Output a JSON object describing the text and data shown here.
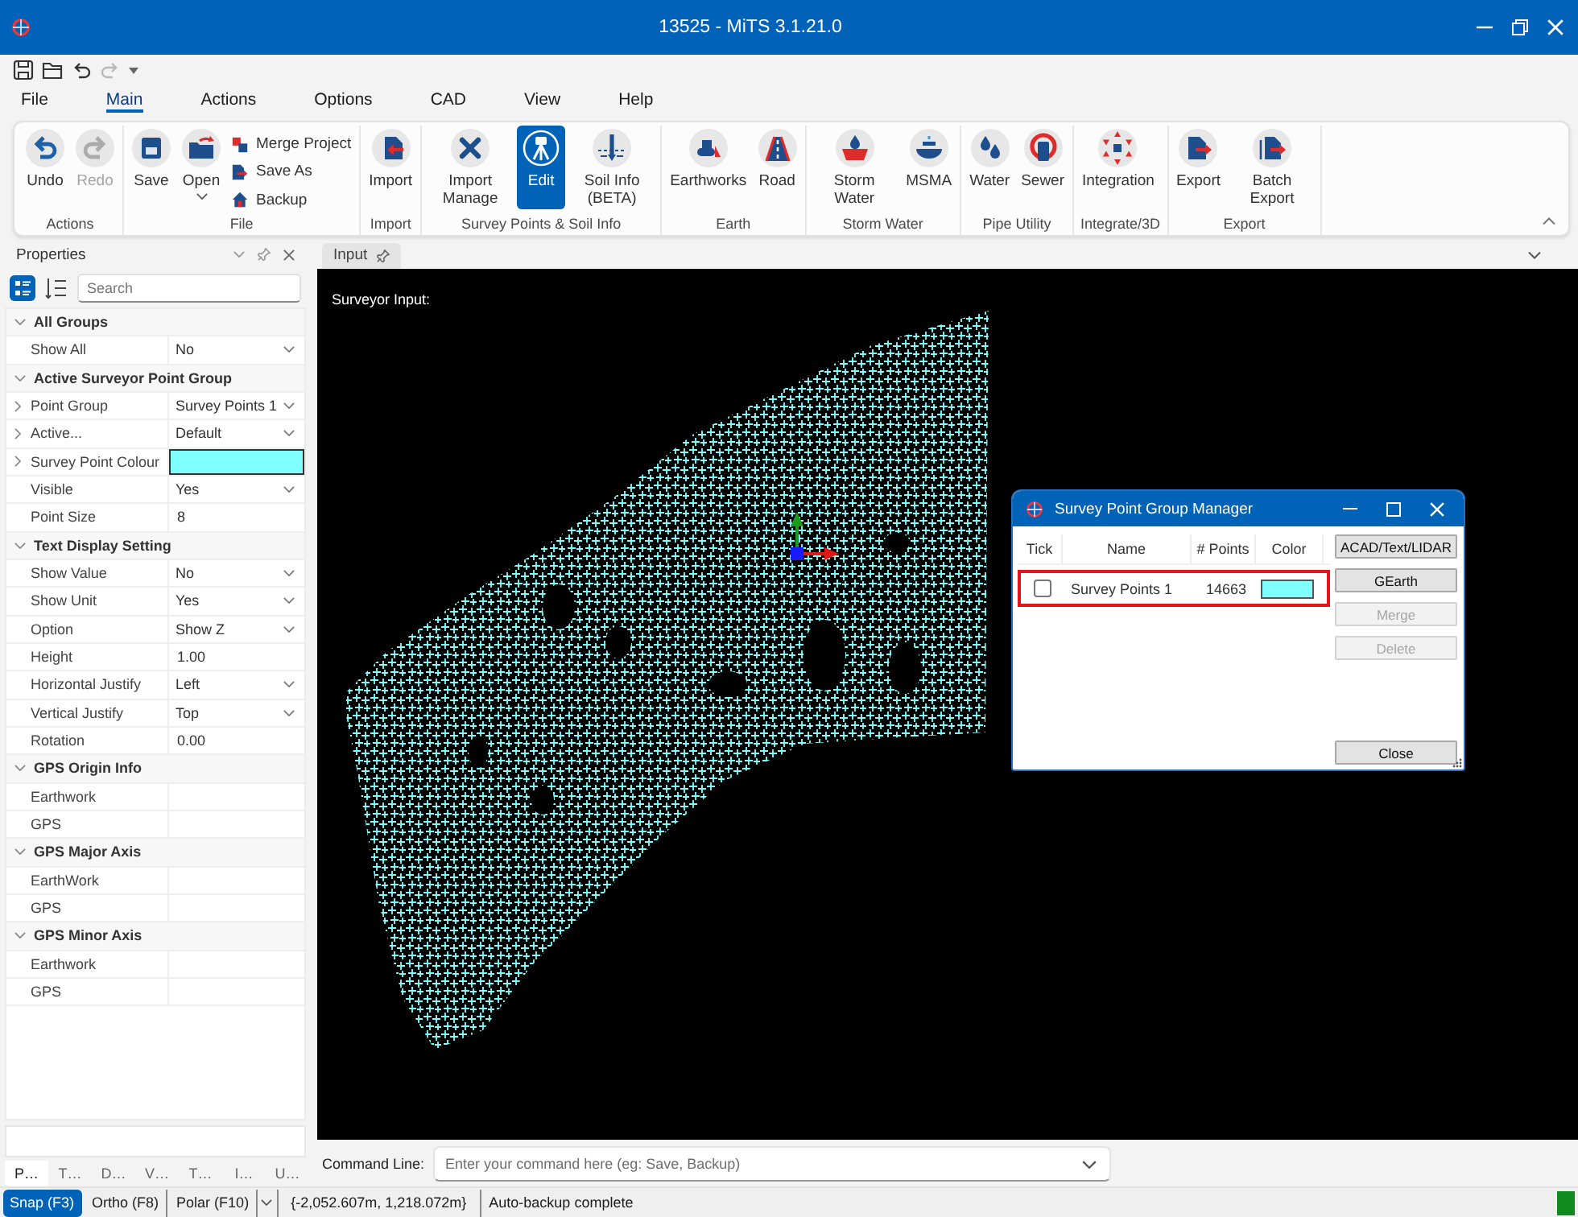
{
  "window": {
    "title": "13525 - MiTS 3.1.21.0"
  },
  "quick_access": [
    {
      "disabled": false
    },
    {
      "disabled": false
    },
    {
      "disabled": false
    },
    {
      "disabled": true
    }
  ],
  "ribbon": {
    "tabs": [
      {
        "label": "File",
        "selected": false
      },
      {
        "label": "Main",
        "selected": true
      },
      {
        "label": "Actions",
        "selected": false
      },
      {
        "label": "Options",
        "selected": false
      },
      {
        "label": "CAD",
        "selected": false
      },
      {
        "label": "View",
        "selected": false
      },
      {
        "label": "Help",
        "selected": false
      }
    ],
    "groups": [
      {
        "label": "Actions",
        "buttons": [
          {
            "label": "Undo",
            "kind": "large",
            "selected": false,
            "disabled": false
          },
          {
            "label": "Redo",
            "kind": "large",
            "selected": false,
            "disabled": true
          }
        ]
      },
      {
        "label": "File",
        "buttons": [
          {
            "label": "Save",
            "kind": "large",
            "selected": false,
            "disabled": false
          },
          {
            "label": "Open",
            "kind": "split",
            "selected": false,
            "disabled": false
          },
          {
            "label": "Merge Project",
            "kind": "small",
            "selected": false,
            "disabled": false
          },
          {
            "label": "Save As",
            "kind": "small",
            "selected": false,
            "disabled": false
          },
          {
            "label": "Backup",
            "kind": "small",
            "selected": false,
            "disabled": false
          }
        ]
      },
      {
        "label": "Import",
        "buttons": [
          {
            "label": "Import",
            "kind": "large",
            "selected": false,
            "disabled": false
          }
        ]
      },
      {
        "label": "Survey Points & Soil Info",
        "buttons": [
          {
            "label": "Import Manage",
            "kind": "large",
            "selected": false,
            "disabled": false
          },
          {
            "label": "Edit",
            "kind": "large",
            "selected": true,
            "disabled": false
          },
          {
            "label": "Soil Info (BETA)",
            "kind": "large",
            "selected": false,
            "disabled": false
          }
        ]
      },
      {
        "label": "Earth",
        "buttons": [
          {
            "label": "Earthworks",
            "kind": "large",
            "selected": false,
            "disabled": false
          },
          {
            "label": "Road",
            "kind": "large",
            "selected": false,
            "disabled": false
          }
        ]
      },
      {
        "label": "Storm Water",
        "buttons": [
          {
            "label": "Storm Water",
            "kind": "large",
            "selected": false,
            "disabled": false
          },
          {
            "label": "MSMA",
            "kind": "large",
            "selected": false,
            "disabled": false
          }
        ]
      },
      {
        "label": "Pipe Utility",
        "buttons": [
          {
            "label": "Water",
            "kind": "large",
            "selected": false,
            "disabled": false
          },
          {
            "label": "Sewer",
            "kind": "large",
            "selected": false,
            "disabled": false
          }
        ]
      },
      {
        "label": "Integrate/3D",
        "buttons": [
          {
            "label": "Integration",
            "kind": "large",
            "selected": false,
            "disabled": false
          }
        ]
      },
      {
        "label": "Export",
        "buttons": [
          {
            "label": "Export",
            "kind": "large",
            "selected": false,
            "disabled": false
          },
          {
            "label": "Batch Export",
            "kind": "large",
            "selected": false,
            "disabled": false
          }
        ]
      }
    ]
  },
  "properties_panel": {
    "title": "Properties",
    "view_modes": [
      {
        "selected": true
      },
      {
        "selected": false
      }
    ],
    "search_placeholder": "Search",
    "groups": [
      {
        "label": "All Groups",
        "expanded": true,
        "rows": [
          {
            "label": "Show All",
            "value": "No",
            "kind": "dropdown",
            "expandable": false
          }
        ]
      },
      {
        "label": "Active Surveyor Point Group",
        "expanded": true,
        "rows": [
          {
            "label": "Point Group",
            "value": "Survey Points 1",
            "kind": "dropdown",
            "expandable": true
          },
          {
            "label": "Active...",
            "value": "Default",
            "kind": "dropdown",
            "expandable": true
          },
          {
            "label": "Survey Point Colour",
            "kind": "color",
            "color": "#80ffff",
            "expandable": true
          },
          {
            "label": "Visible",
            "value": "Yes",
            "kind": "dropdown",
            "expandable": false
          },
          {
            "label": "Point Size",
            "value": "8",
            "kind": "text",
            "expandable": false
          }
        ]
      },
      {
        "label": "Text Display Setting",
        "expanded": true,
        "rows": [
          {
            "label": "Show Value",
            "value": "No",
            "kind": "dropdown",
            "expandable": false
          },
          {
            "label": "Show Unit",
            "value": "Yes",
            "kind": "dropdown",
            "expandable": false
          },
          {
            "label": "Option",
            "value": "Show Z",
            "kind": "dropdown",
            "expandable": false
          },
          {
            "label": "Height",
            "value": "1.00",
            "kind": "text",
            "expandable": false
          },
          {
            "label": "Horizontal Justify",
            "value": "Left",
            "kind": "dropdown",
            "expandable": false
          },
          {
            "label": "Vertical Justify",
            "value": "Top",
            "kind": "dropdown",
            "expandable": false
          },
          {
            "label": "Rotation",
            "value": "0.00",
            "kind": "text",
            "expandable": false
          }
        ]
      },
      {
        "label": "GPS Origin Info",
        "expanded": true,
        "rows": [
          {
            "label": "Earthwork",
            "kind": "text",
            "expandable": false
          },
          {
            "label": "GPS",
            "kind": "text",
            "expandable": false
          }
        ]
      },
      {
        "label": "GPS Major Axis",
        "expanded": true,
        "rows": [
          {
            "label": "EarthWork",
            "kind": "text",
            "expandable": false
          },
          {
            "label": "GPS",
            "kind": "text",
            "expandable": false
          }
        ]
      },
      {
        "label": "GPS Minor Axis",
        "expanded": true,
        "rows": [
          {
            "label": "Earthwork",
            "kind": "text",
            "expandable": false
          },
          {
            "label": "GPS",
            "kind": "text",
            "expandable": false
          }
        ]
      }
    ],
    "tabs": [
      {
        "label": "P…",
        "selected": true
      },
      {
        "label": "T…",
        "selected": false
      },
      {
        "label": "D…",
        "selected": false
      },
      {
        "label": "V…",
        "selected": false
      },
      {
        "label": "T…",
        "selected": false
      },
      {
        "label": "I…",
        "selected": false
      },
      {
        "label": "U…",
        "selected": false
      }
    ]
  },
  "document": {
    "tabs": [
      {
        "label": "Input",
        "selected": true
      }
    ],
    "canvas_label": "Surveyor Input:"
  },
  "dialog": {
    "title": "Survey Point Group Manager",
    "columns": [
      "Tick",
      "Name",
      "# Points",
      "Color"
    ],
    "rows": [
      {
        "checked": false,
        "name": "Survey Points 1",
        "points": "14663",
        "color": "#80ffff",
        "highlighted": true
      }
    ],
    "buttons": [
      {
        "label": "ACAD/Text/LIDAR",
        "disabled": false
      },
      {
        "label": "GEarth",
        "disabled": false
      },
      {
        "label": "Merge",
        "disabled": true
      },
      {
        "label": "Delete",
        "disabled": true
      }
    ],
    "close_button": {
      "label": "Close"
    }
  },
  "command_line": {
    "label": "Command Line:",
    "placeholder": "Enter your command here (eg: Save, Backup)"
  },
  "status_bar": {
    "toggles": [
      {
        "label": "Snap (F3)",
        "on": true
      },
      {
        "label": "Ortho (F8)",
        "on": false
      },
      {
        "label": "Polar (F10)",
        "on": false
      }
    ],
    "coordinates": "{-2,052.607m, 1,218.072m}",
    "message": "Auto-backup complete"
  }
}
